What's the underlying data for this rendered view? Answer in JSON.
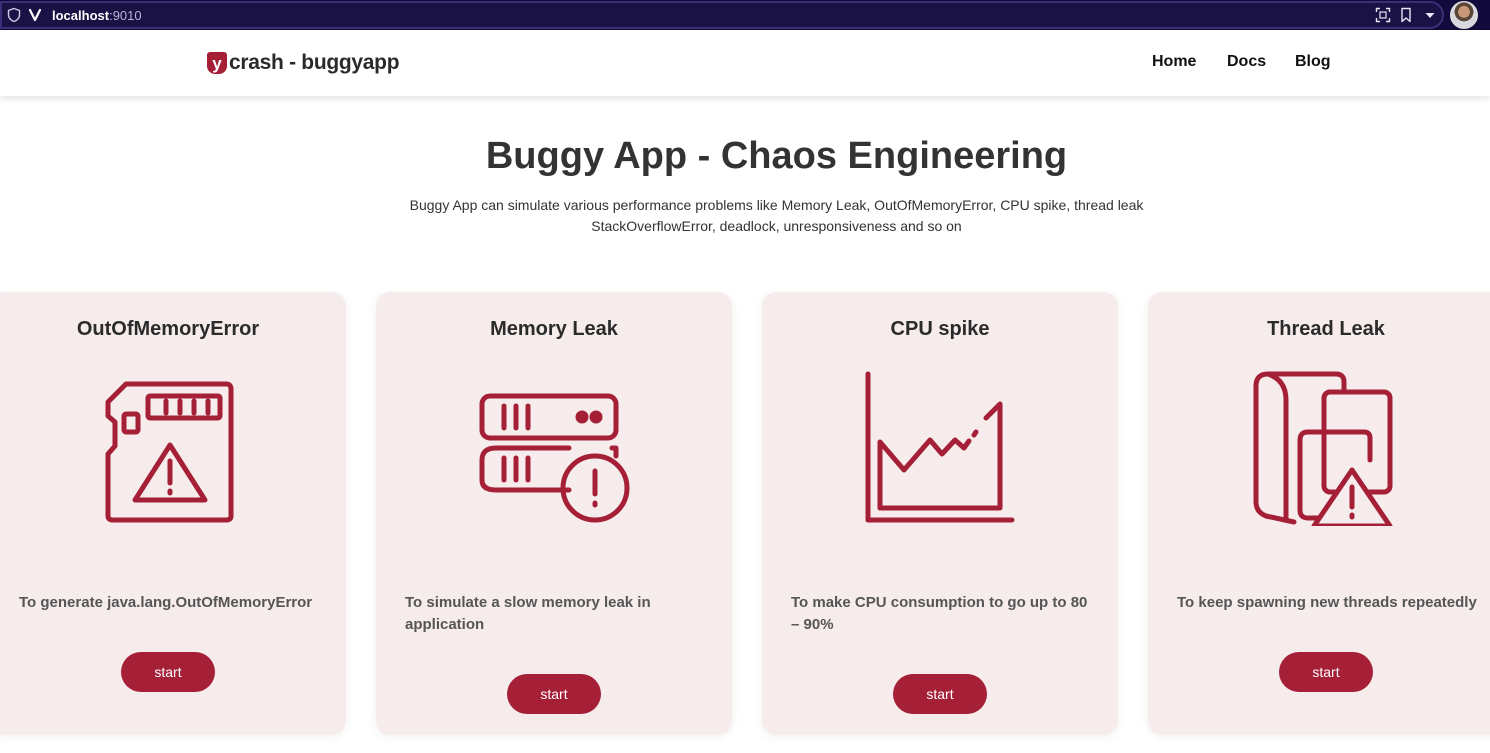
{
  "browser": {
    "url_host": "localhost",
    "url_port": ":9010",
    "icons": [
      "shield-icon",
      "vivaldi-logo-icon",
      "capture-icon",
      "bookmark-icon",
      "chevron-down-icon",
      "profile-avatar"
    ]
  },
  "header": {
    "logo_mark": "y",
    "logo_text": "crash - buggyapp",
    "nav": [
      "Home",
      "Docs",
      "Blog"
    ]
  },
  "hero": {
    "title": "Buggy App - Chaos Engineering",
    "description_line1": "Buggy App can simulate various performance problems like Memory Leak, OutOfMemoryError, CPU spike, thread leak",
    "description_line2": "StackOverflowError, deadlock, unresponsiveness and so on"
  },
  "cards": [
    {
      "title": "OutOfMemoryError",
      "description": "To generate java.lang.OutOfMemoryError",
      "button": "start",
      "icon": "memory-card-warning-icon"
    },
    {
      "title": "Memory Leak",
      "description": "To simulate a slow memory leak in application",
      "button": "start",
      "icon": "server-alert-icon"
    },
    {
      "title": "CPU spike",
      "description": "To make CPU consumption to go up to 80 – 90%",
      "button": "start",
      "icon": "line-chart-spike-icon"
    },
    {
      "title": "Thread Leak",
      "description": "To keep spawning new threads repeatedly",
      "button": "start",
      "icon": "folders-warning-icon"
    }
  ],
  "colors": {
    "accent": "#a51f37",
    "card_bg": "#f7ecec",
    "browser_bar": "#120a3a"
  }
}
